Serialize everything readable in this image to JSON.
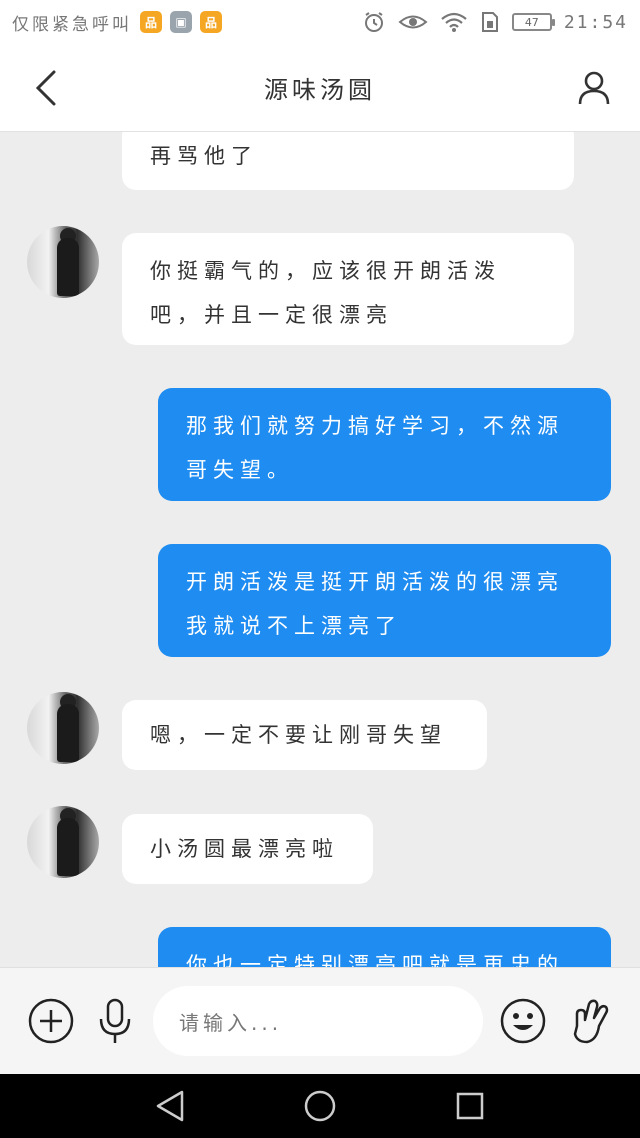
{
  "status_bar": {
    "carrier_text": "仅限紧急呼叫",
    "battery": "47",
    "time": "21:54",
    "app_badges": [
      "app-orange",
      "gallery",
      "app-orange-2"
    ]
  },
  "header": {
    "title": "源味汤圆"
  },
  "messages": [
    {
      "side": "in",
      "text": "再骂他了",
      "has_avatar": false
    },
    {
      "side": "in",
      "lines": [
        "你挺霸气的，应该很开朗活泼",
        "吧，并且一定很漂亮"
      ],
      "has_avatar": true
    },
    {
      "side": "out",
      "lines": [
        "那我们就努力搞好学习，不然源",
        "哥失望。"
      ]
    },
    {
      "side": "out",
      "lines": [
        "开朗活泼是挺开朗活泼的很漂亮",
        "我就说不上漂亮了"
      ]
    },
    {
      "side": "in",
      "text": "嗯，一定不要让刚哥失望",
      "has_avatar": true
    },
    {
      "side": "in",
      "text": "小汤圆最漂亮啦",
      "has_avatar": true
    },
    {
      "side": "out",
      "text": "你也一定特别漂亮吧就是再忠的"
    }
  ],
  "input_bar": {
    "placeholder": "请输入..."
  },
  "colors": {
    "outgoing_bubble": "#1e8cf0",
    "incoming_bubble": "#ffffff",
    "chat_background": "#ededed"
  },
  "icons": [
    "back-arrow-icon",
    "profile-icon",
    "add-circle-icon",
    "microphone-icon",
    "emoji-icon",
    "gesture-hand-icon",
    "nav-back-icon",
    "nav-home-icon",
    "nav-recents-icon"
  ]
}
